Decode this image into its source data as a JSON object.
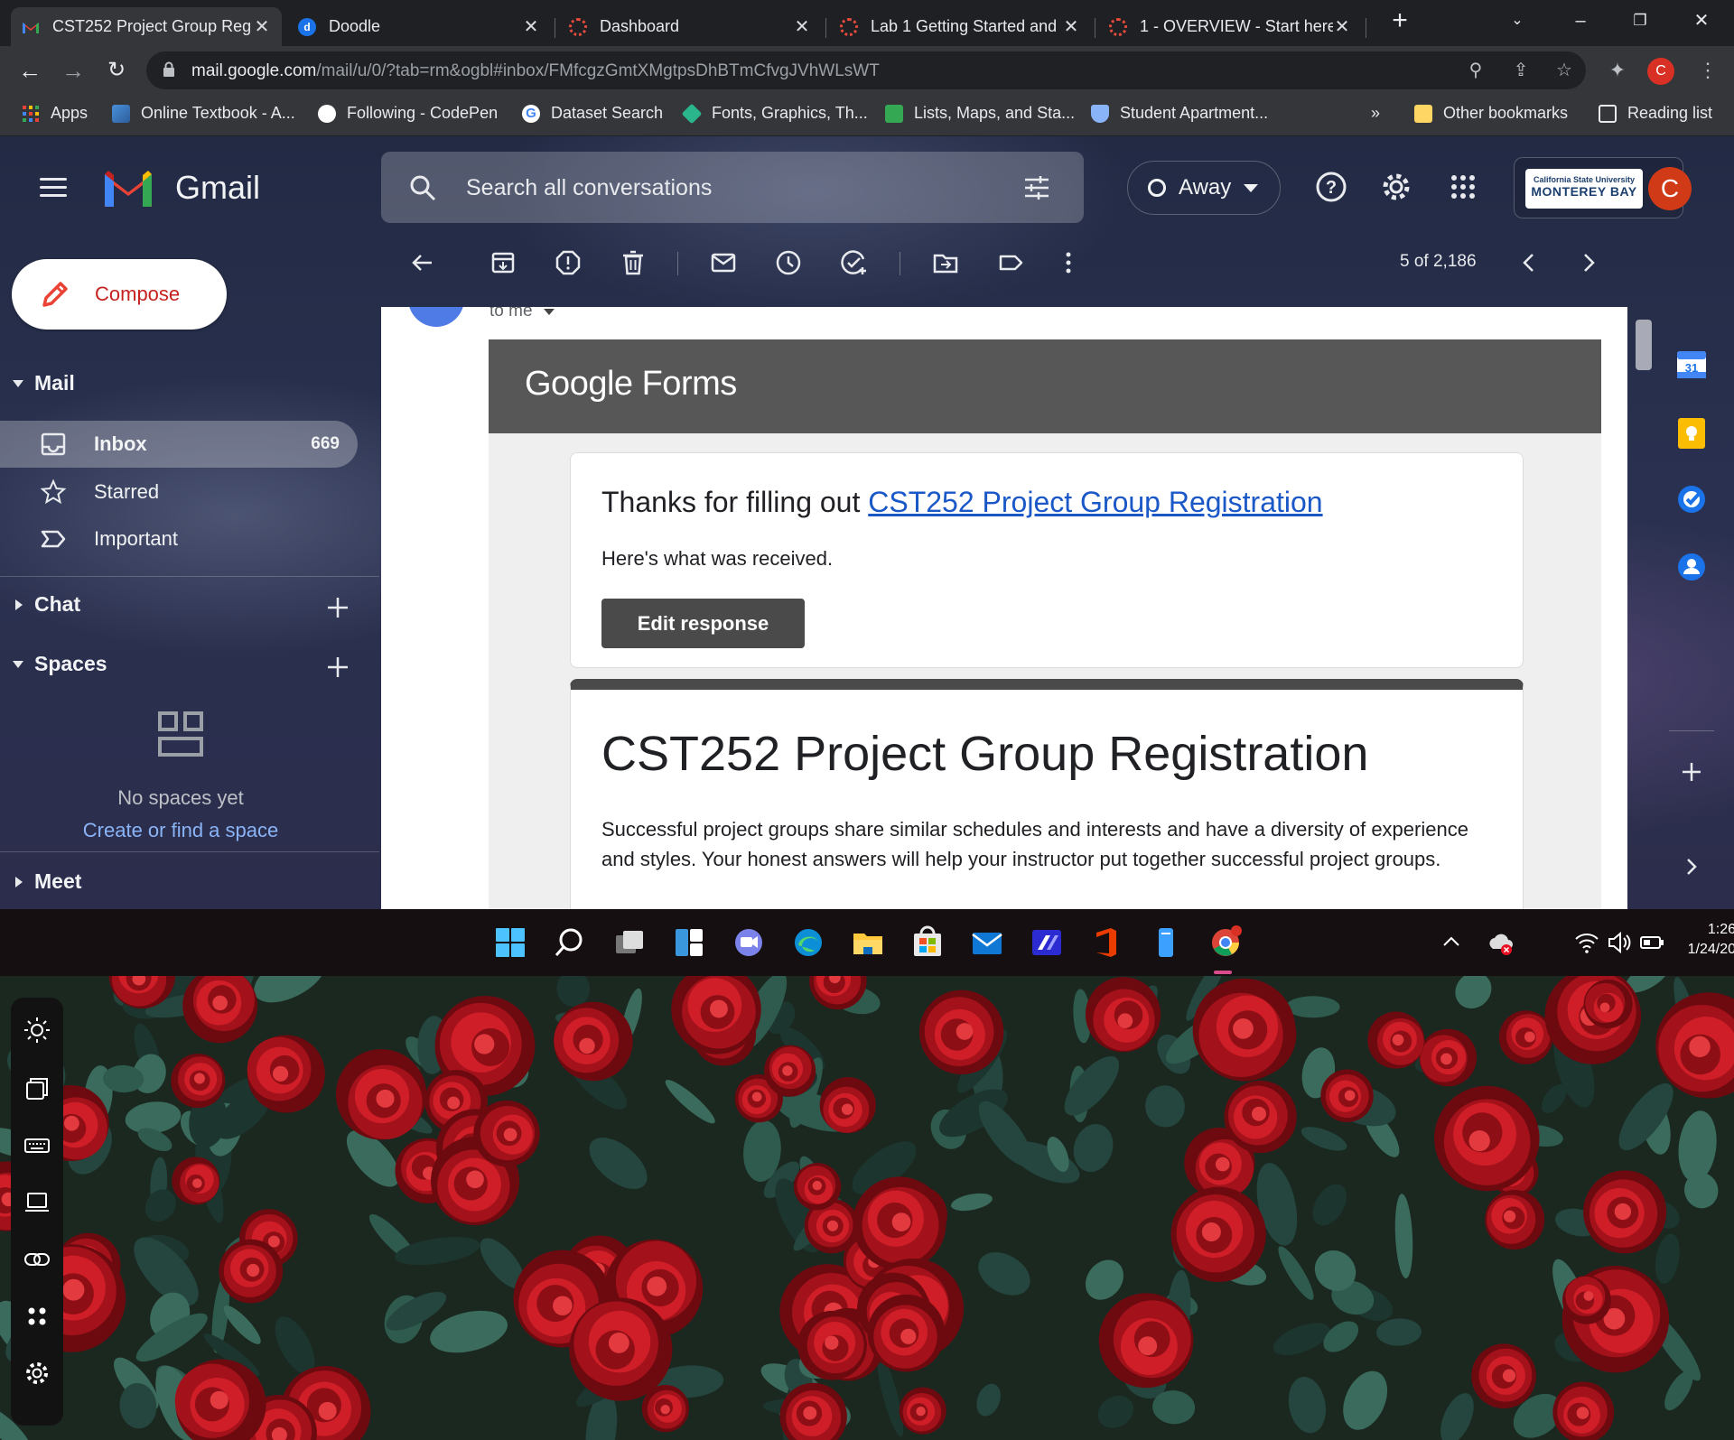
{
  "browser": {
    "tabs": [
      {
        "title": "CST252 Project Group Reg",
        "favicon": "gmail-icon",
        "active": true
      },
      {
        "title": "Doodle",
        "favicon": "doodle-icon",
        "active": false
      },
      {
        "title": "Dashboard",
        "favicon": "canvas-icon",
        "active": false
      },
      {
        "title": "Lab 1 Getting Started and",
        "favicon": "canvas-icon",
        "active": false
      },
      {
        "title": "1 - OVERVIEW - Start here",
        "favicon": "canvas-icon",
        "active": false
      }
    ],
    "address": {
      "host": "mail.google.com",
      "path": "/mail/u/0/?tab=rm&ogbl#inbox/FMfcgzGmtXMgtpsDhBTmCfvgJVhWLsWT"
    },
    "profile_initial": "C",
    "bookmarks": [
      {
        "label": "Apps",
        "icon": "apps-grid-icon",
        "color": "#ea4335"
      },
      {
        "label": "Online Textbook - A...",
        "icon": "textbook-icon",
        "color": "#4a90d9"
      },
      {
        "label": "Following - CodePen",
        "icon": "codepen-icon",
        "color": "#ffffff"
      },
      {
        "label": "Dataset Search",
        "icon": "google-icon",
        "color": "#4285f4"
      },
      {
        "label": "Fonts, Graphics, Th...",
        "icon": "diamond-icon",
        "color": "#2bb58c"
      },
      {
        "label": "Lists, Maps, and Sta...",
        "icon": "sheet-icon",
        "color": "#34a853"
      },
      {
        "label": "Student Apartment...",
        "icon": "shield-icon",
        "color": "#8ab4f8"
      }
    ],
    "bookmarks_overflow": "»",
    "other_bookmarks": "Other bookmarks",
    "reading_list": "Reading list"
  },
  "gmail": {
    "wordmark": "Gmail",
    "search_placeholder": "Search all conversations",
    "status": "Away",
    "account": {
      "school_line1": "California State University",
      "school_line2": "MONTEREY BAY",
      "avatar_initial": "C"
    },
    "compose_label": "Compose",
    "sections": {
      "mail": "Mail",
      "chat": "Chat",
      "spaces": "Spaces",
      "meet": "Meet"
    },
    "nav": [
      {
        "label": "Inbox",
        "count": "669",
        "icon": "inbox-icon"
      },
      {
        "label": "Starred",
        "count": "",
        "icon": "star-icon"
      },
      {
        "label": "Important",
        "count": "",
        "icon": "important-icon"
      }
    ],
    "spaces_empty": {
      "title": "No spaces yet",
      "link": "Create or find a space"
    },
    "pager": "5 of 2,186",
    "message": {
      "to": "to me",
      "banner_logo": "Google Forms",
      "thanks_prefix": "Thanks for filling out ",
      "thanks_link": "CST252 Project Group Registration",
      "received": "Here's what was received.",
      "edit_button": "Edit response",
      "form_title": "CST252 Project Group Registration",
      "form_description": "Successful project groups share similar schedules and interests and have a diversity of experience and styles. Your honest answers will help your instructor put together successful project groups."
    }
  },
  "taskbar": {
    "time": "1:26",
    "date": "1/24/20"
  },
  "colors": {
    "gmail_red": "#ea4335",
    "compose_text": "#c5221f",
    "link_blue": "#1a57c7",
    "forms_banner": "#575757",
    "avatar": "#d03a17"
  }
}
